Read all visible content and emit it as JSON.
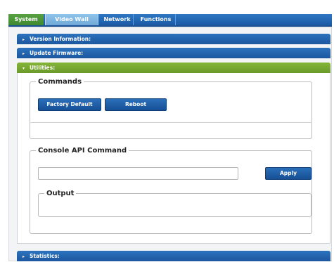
{
  "tabs": [
    {
      "label": "System"
    },
    {
      "label": "Video Wall"
    },
    {
      "label": "Network"
    },
    {
      "label": "Functions"
    }
  ],
  "sections": {
    "version": {
      "label": "Version Information:",
      "arrow": "▸"
    },
    "firmware": {
      "label": "Update Firmware:",
      "arrow": "▸"
    },
    "utilities": {
      "label": "Utilities:",
      "arrow": "▾"
    },
    "statistics": {
      "label": "Statistics:",
      "arrow": "▸"
    }
  },
  "commands": {
    "legend": "Commands",
    "factory_default": "Factory Default",
    "reboot": "Reboot"
  },
  "console": {
    "legend": "Console API Command",
    "input_value": "",
    "apply": "Apply",
    "output_legend": "Output"
  },
  "colors": {
    "tab_active": "#4e9a3a",
    "bar_blue": "#1f5fa8",
    "bar_green": "#79a833",
    "button_blue": "#1f5da6"
  }
}
